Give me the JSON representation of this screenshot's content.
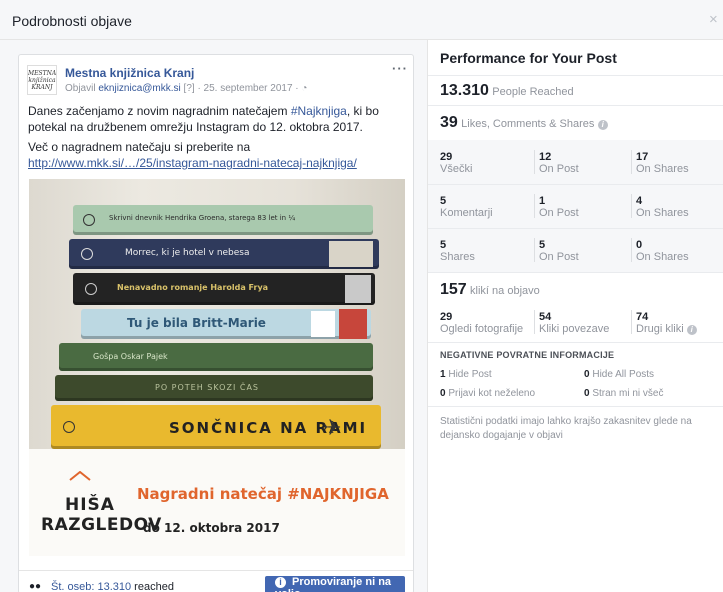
{
  "dialog": {
    "title": "Podrobnosti objave",
    "close_icon": "×"
  },
  "post": {
    "avatar_text": "MESTNA knjižnica KRANJ",
    "page_name": "Mestna knjižnica Kranj",
    "meta_prefix": "Objavil",
    "author": "eknjiznica@mkk.si",
    "meta_suffix": " [?] · 25. september 2017 · ",
    "audience_icon": "globe-icon",
    "more_dots": "···",
    "text_line1_before": "Danes začenjamo z novim nagradnim natečajem ",
    "hashtag": "#Najknjiga",
    "text_line1_after": ", ki bo potekal na družbenem omrežju Instagram do 12. oktobra 2017.",
    "text_line2": "Več o nagradnem natečaju si preberite na",
    "link": "http://www.mkk.si/…/25/instagram-nagradni-natecaj-najknjiga/",
    "image": {
      "books": [
        "Skrivni dnevnik Hendrika Groena, starega 83 let in ¼",
        "Morrec, ki je hotel v nebesa",
        "Nenavadno romanje Harolda Frya",
        "Tu je bila Britt-Marie",
        "Gošpa Oskar Pajek",
        "PO POTEH SKOZI ČAS",
        "SONČNICA NA RAMI"
      ],
      "logo_line1": "HIŠA",
      "logo_line2": "RAZGLEDOV",
      "contest_title": "Nagradni natečaj #NAJKNJIGA",
      "contest_date": "do 12. oktobra 2017"
    },
    "footer": {
      "reach_link": "Št. oseb: 13.310",
      "reach_suffix": " reached",
      "promote_label": "Promoviranje ni na voljo"
    }
  },
  "performance": {
    "title": "Performance for Your Post",
    "people_reached": {
      "value": "13.310",
      "label": "People Reached"
    },
    "engagement": {
      "value": "39",
      "label": "Likes, Comments & Shares"
    },
    "rows": [
      {
        "cells": [
          {
            "num": "29",
            "lbl": "Všečki"
          },
          {
            "num": "12",
            "lbl": "On Post"
          },
          {
            "num": "17",
            "lbl": "On Shares"
          }
        ]
      },
      {
        "cells": [
          {
            "num": "5",
            "lbl": "Komentarji"
          },
          {
            "num": "1",
            "lbl": "On Post"
          },
          {
            "num": "4",
            "lbl": "On Shares"
          }
        ]
      },
      {
        "cells": [
          {
            "num": "5",
            "lbl": "Shares"
          },
          {
            "num": "5",
            "lbl": "On Post"
          },
          {
            "num": "0",
            "lbl": "On Shares"
          }
        ]
      }
    ],
    "clicks": {
      "value": "157",
      "label": "klikí na objavo"
    },
    "click_row": [
      {
        "num": "29",
        "lbl": "Ogledi fotografije"
      },
      {
        "num": "54",
        "lbl": "Kliki povezave"
      },
      {
        "num": "74",
        "lbl": "Drugi kliki"
      }
    ],
    "negative": {
      "title": "NEGATIVNE POVRATNE INFORMACIJE",
      "items": [
        {
          "num": "1",
          "lbl": "Hide Post"
        },
        {
          "num": "0",
          "lbl": "Hide All Posts"
        },
        {
          "num": "0",
          "lbl": "Prijavi kot neželeno"
        },
        {
          "num": "0",
          "lbl": "Stran mi ni všeč"
        }
      ]
    },
    "footnote": "Statistični podatki imajo lahko krajšo zakasnitev glede na dejansko dogajanje v objavi"
  }
}
